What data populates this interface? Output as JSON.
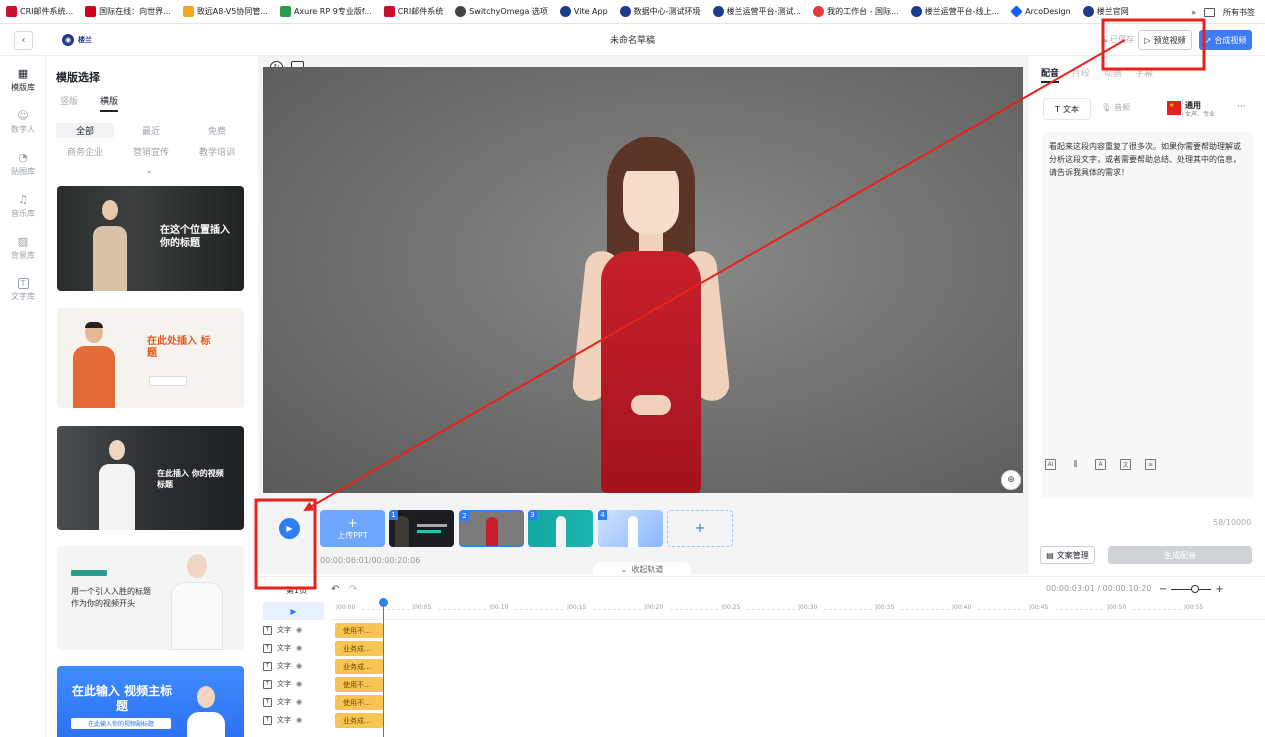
{
  "bookmarks": [
    {
      "label": "CRI邮件系统...",
      "color": "#c8102e"
    },
    {
      "label": "国际在线：向世界...",
      "color": "#d0021b"
    },
    {
      "label": "致远A8-V5协同管...",
      "color": "#f5a623"
    },
    {
      "label": "Axure RP 9专业版f...",
      "color": "#2a9d4a"
    },
    {
      "label": "CRI邮件系统",
      "color": "#c8102e"
    },
    {
      "label": "SwitchyOmega 选项",
      "color": "#444444"
    },
    {
      "label": "Vite App",
      "color": "#1e3b8a"
    },
    {
      "label": "数据中心-测试环境",
      "color": "#1e3b8a"
    },
    {
      "label": "楼兰运营平台-测试...",
      "color": "#1e3b8a"
    },
    {
      "label": "我的工作台 - 国际...",
      "color": "#e4393c"
    },
    {
      "label": "楼兰运营平台-线上...",
      "color": "#1e3b8a"
    },
    {
      "label": "ArcoDesign",
      "color": "#165dff"
    },
    {
      "label": "楼兰官网",
      "color": "#1e3b8a"
    }
  ],
  "bookmarks_more": "»",
  "bookmarks_all": "所有书签",
  "header": {
    "back_icon": "chevron-left-icon",
    "logo_text": "楼兰",
    "title": "未命名草稿",
    "saved": "已保存",
    "preview_label": "预览视频",
    "compose_label": "合成视频"
  },
  "sidenav": [
    {
      "label": "模版库",
      "icon": "▦",
      "active": true
    },
    {
      "label": "数字人",
      "icon": "☺"
    },
    {
      "label": "贴图库",
      "icon": "◔"
    },
    {
      "label": "音乐库",
      "icon": "♫"
    },
    {
      "label": "背景库",
      "icon": "▨"
    },
    {
      "label": "文字库",
      "icon": "T"
    }
  ],
  "library": {
    "title": "模版选择",
    "tabs": [
      "竖版",
      "横版"
    ],
    "active_tab": 1,
    "chips_row1": [
      "全部",
      "最近",
      "免费"
    ],
    "chips_row2": [
      "商务企业",
      "营销宣传",
      "教学培训"
    ],
    "cards": [
      {
        "title": "在这个位置插入 你的标题"
      },
      {
        "title": "在此处插入 标题"
      },
      {
        "title": "在此插入 你的视频标题"
      },
      {
        "title": "用一个引人入胜的标题 作为你的视频开头"
      },
      {
        "title": "在此输入 视频主标题",
        "subtitle": "在此输入你的视频副标题"
      }
    ]
  },
  "stage": {
    "play_icon": "play-icon",
    "upload_label": "上传PPT",
    "scenes": [
      "1",
      "2",
      "3",
      "4"
    ],
    "time": "00:00:06:01/00:00:20:06",
    "collapse_label": "收起轨道"
  },
  "right": {
    "tabs": [
      "配音",
      "片段",
      "动画",
      "字幕"
    ],
    "active_tab": 0,
    "text_mode": "文本",
    "audio_mode": "音频",
    "voice_name": "通用",
    "voice_sub": "女声、专业",
    "script": "看起来这段内容重复了很多次。如果你需要帮助理解或分析这段文字，或者需要帮助总结、处理其中的信息，请告诉我具体的需求！",
    "count": "58/10000",
    "doc_btn": "文案管理",
    "gen_btn": "生成配音"
  },
  "timeline": {
    "first_page": "第1页",
    "time": "00:00:03:01 / 00:00:10:20",
    "ticks": [
      "|00:00",
      "|00:05",
      "|00:10",
      "|00:15",
      "|00:20",
      "|00:25",
      "|00:30",
      "|00:35",
      "|00:40",
      "|00:45",
      "|00:50",
      "|00:55"
    ],
    "tracks": [
      {
        "label": "文字",
        "clip": "使用不..."
      },
      {
        "label": "文字",
        "clip": "业务成..."
      },
      {
        "label": "文字",
        "clip": "业务成..."
      },
      {
        "label": "文字",
        "clip": "使用不..."
      },
      {
        "label": "文字",
        "clip": "使用不..."
      },
      {
        "label": "文字",
        "clip": "业务成..."
      }
    ]
  },
  "annotation_color": "#e8211d"
}
